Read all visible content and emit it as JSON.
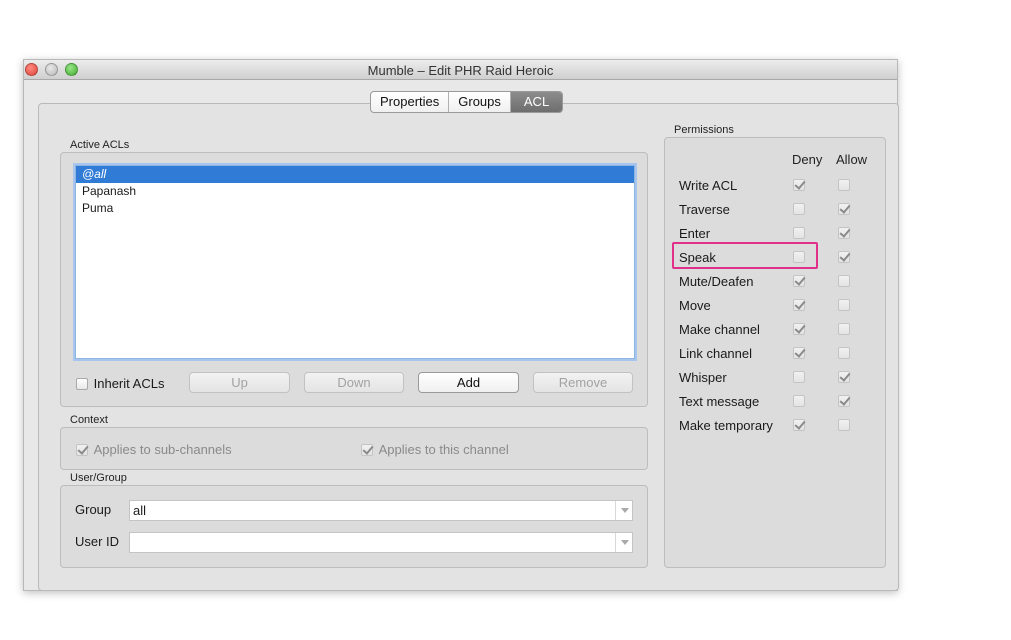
{
  "window": {
    "title": "Mumble – Edit PHR Raid Heroic"
  },
  "tabs": [
    {
      "label": "Properties",
      "active": false
    },
    {
      "label": "Groups",
      "active": false
    },
    {
      "label": "ACL",
      "active": true
    }
  ],
  "active_acls": {
    "label": "Active ACLs",
    "items": [
      "@all",
      "Papanash",
      "Puma"
    ],
    "selected": "@all",
    "inherit_label": "Inherit ACLs",
    "inherit_checked": false,
    "buttons": {
      "up": "Up",
      "down": "Down",
      "add": "Add",
      "remove": "Remove"
    }
  },
  "context": {
    "label": "Context",
    "applies_sub": "Applies to sub-channels",
    "applies_this": "Applies to this channel"
  },
  "user_group": {
    "label": "User/Group",
    "group_label": "Group",
    "group_value": "all",
    "userid_label": "User ID",
    "userid_value": ""
  },
  "permissions": {
    "label": "Permissions",
    "deny_header": "Deny",
    "allow_header": "Allow",
    "rows": [
      {
        "label": "Write ACL",
        "deny": true,
        "allow": false
      },
      {
        "label": "Traverse",
        "deny": false,
        "allow": true
      },
      {
        "label": "Enter",
        "deny": false,
        "allow": true
      },
      {
        "label": "Speak",
        "deny": false,
        "allow": true
      },
      {
        "label": "Mute/Deafen",
        "deny": true,
        "allow": false
      },
      {
        "label": "Move",
        "deny": true,
        "allow": false
      },
      {
        "label": "Make channel",
        "deny": true,
        "allow": false
      },
      {
        "label": "Link channel",
        "deny": true,
        "allow": false
      },
      {
        "label": "Whisper",
        "deny": false,
        "allow": true
      },
      {
        "label": "Text message",
        "deny": false,
        "allow": true
      },
      {
        "label": "Make temporary",
        "deny": true,
        "allow": false
      }
    ]
  },
  "colors": {
    "highlight": "#e0308a",
    "selection": "#2f7bd6"
  }
}
